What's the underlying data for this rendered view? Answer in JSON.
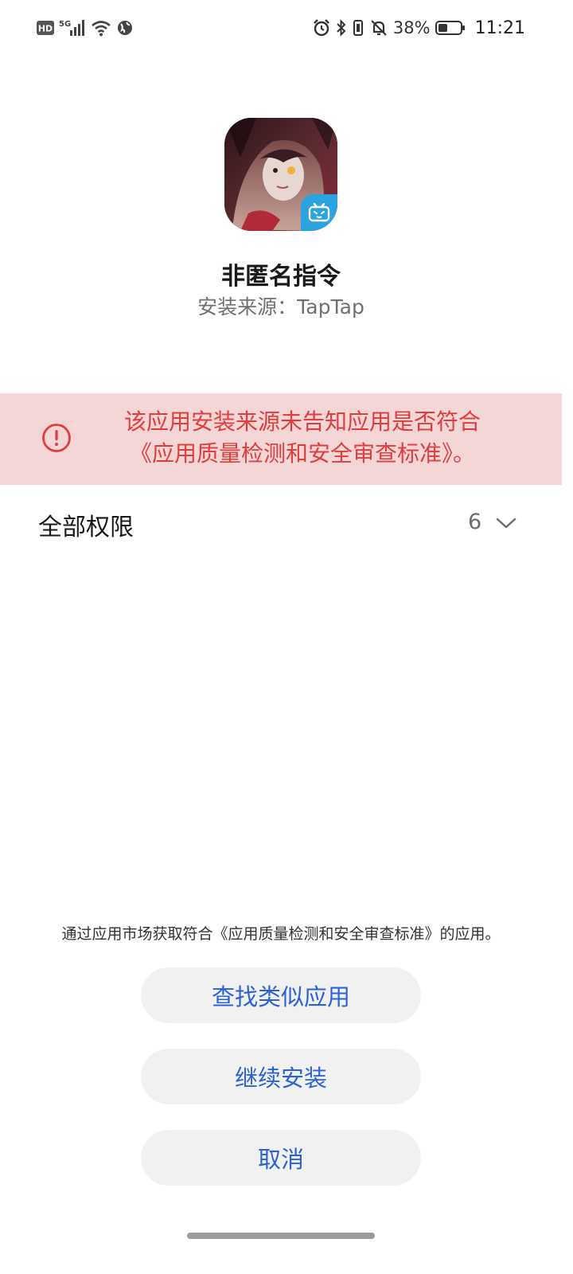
{
  "status_bar": {
    "hd_label": "HD",
    "network_label": "5G",
    "battery_percent": "38%",
    "time": "11:21",
    "icons": [
      "hd-icon",
      "signal-icon",
      "wifi-icon",
      "globe-icon",
      "alarm-icon",
      "bluetooth-icon",
      "vibrate-icon",
      "mute-icon",
      "battery-icon"
    ]
  },
  "app": {
    "name": "非匿名指令",
    "install_source": "安装来源：TapTap",
    "icon": "app-icon",
    "badge_icon": "bilibili-icon"
  },
  "warning": {
    "icon": "alert-circle-icon",
    "line1": "该应用安装来源未告知应用是否符合",
    "line2": "《应用质量检测和安全审查标准》。",
    "color": "#e03d3d",
    "background": "#f4d6d6"
  },
  "permissions": {
    "label": "全部权限",
    "count": "6",
    "expand_icon": "chevron-down-icon"
  },
  "footer": {
    "notice": "通过应用市场获取符合《应用质量检测和安全审查标准》的应用。",
    "buttons": {
      "find_similar": "查找类似应用",
      "continue_install": "继续安装",
      "cancel": "取消"
    },
    "accent_color": "#2c62d8"
  }
}
